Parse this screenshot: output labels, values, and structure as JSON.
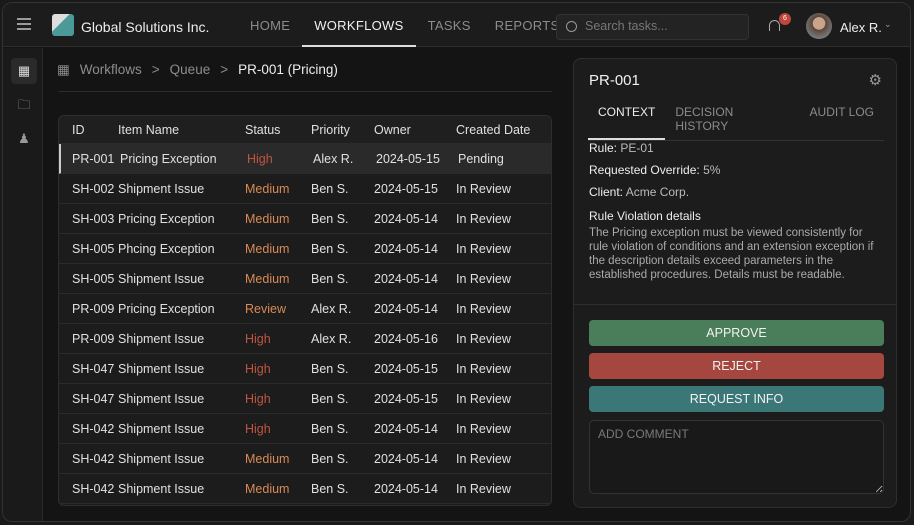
{
  "header": {
    "brand": "Global Solutions Inc.",
    "nav": [
      "HOME",
      "WORKFLOWS",
      "TASKS",
      "REPORTS"
    ],
    "active_nav": 1,
    "search_placeholder": "Search tasks...",
    "notification_count": "6",
    "user": "Alex R."
  },
  "breadcrumb": [
    "Workflows",
    "Queue",
    "PR-001 (Pricing)"
  ],
  "table": {
    "columns": [
      "ID",
      "Item Name",
      "Status",
      "Priority",
      "Owner",
      "Created Date"
    ],
    "rows": [
      [
        "PR-001",
        "Pricing Exception",
        "High",
        "Alex R.",
        "2024-05-15",
        "Pending"
      ],
      [
        "SH-002",
        "Shipment Issue",
        "Medium",
        "Ben S.",
        "2024-05-15",
        "In Review"
      ],
      [
        "SH-003",
        "Pricing Exception",
        "Medium",
        "Ben S.",
        "2024-05-14",
        "In Review"
      ],
      [
        "SH-005",
        "Phcing Exception",
        "Medium",
        "Ben S.",
        "2024-05-14",
        "In Review"
      ],
      [
        "SH-005",
        "Shipment Issue",
        "Medium",
        "Ben S.",
        "2024-05-14",
        "In Review"
      ],
      [
        "PR-009",
        "Pricing Exception",
        "Review",
        "Alex R.",
        "2024-05-14",
        "In Review"
      ],
      [
        "PR-009",
        "Shipment Issue",
        "High",
        "Alex R.",
        "2024-05-16",
        "In Review"
      ],
      [
        "SH-047",
        "Shipment Issue",
        "High",
        "Ben S.",
        "2024-05-15",
        "In Review"
      ],
      [
        "SH-047",
        "Shipment Issue",
        "High",
        "Ben S.",
        "2024-05-15",
        "In Review"
      ],
      [
        "SH-042",
        "Shipment Issue",
        "High",
        "Ben S.",
        "2024-05-14",
        "In Review"
      ],
      [
        "SH-042",
        "Shipment Issue",
        "Medium",
        "Ben S.",
        "2024-05-14",
        "In Review"
      ],
      [
        "SH-042",
        "Shipment Issue",
        "Medium",
        "Ben S.",
        "2024-05-14",
        "In Review"
      ]
    ]
  },
  "detail": {
    "title": "PR-001",
    "tabs": [
      "CONTEXT",
      "DECISION HISTORY",
      "AUDIT LOG"
    ],
    "rule_label": "Rule:",
    "rule": "PE-01",
    "override_label": "Requested Override:",
    "override": "5%",
    "client_label": "Client:",
    "client": "Acme Corp.",
    "violation_heading": "Rule Violation details",
    "violation_text": "The Pricing exception must be viewed consistently for rule violation of conditions and an extension exception if the description details exceed parameters in the established procedures. Details must be readable.",
    "approve": "APPROVE",
    "reject": "REJECT",
    "request_info": "REQUEST INFO",
    "comment_placeholder": "ADD COMMENT"
  },
  "colors": {
    "approve": "#4a7d5a",
    "reject": "#a5463f",
    "request": "#3a7776",
    "high": "#c0553f",
    "medium": "#d98a55"
  }
}
